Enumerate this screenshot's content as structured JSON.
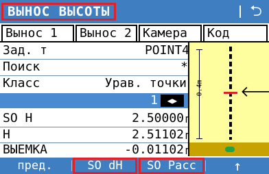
{
  "title": "ВЫНОС ВЫСОТЫ",
  "back_icon": "⮌",
  "tabs": [
    "Вынос 1",
    "Вынос 2",
    "Камера",
    "Код"
  ],
  "fields": {
    "point_label": "Зад. т",
    "point_value": "POINT4",
    "search_label": "Поиск",
    "search_value": "*",
    "class_label": "Класс",
    "class_value": "Урав. точки",
    "page_value": "1",
    "so_h_label": "SO H",
    "so_h_value": "2.50000",
    "so_h_unit": "m",
    "h_label": "H",
    "h_value": "2.51102",
    "h_unit": "m",
    "cut_label": "ВЫЕМКА",
    "cut_value": "-0.01102",
    "cut_unit": "m"
  },
  "panel": {
    "distance_label": "0.4m",
    "arrow_icon": "arrow-left-icon"
  },
  "softkeys": [
    "пред.",
    "SO dH",
    "SO Расс",
    "↑"
  ],
  "colors": {
    "accent": "#3f7fc1",
    "highlight": "#e0202a",
    "panel": "#fffe9e",
    "ground": "#c8a300"
  }
}
